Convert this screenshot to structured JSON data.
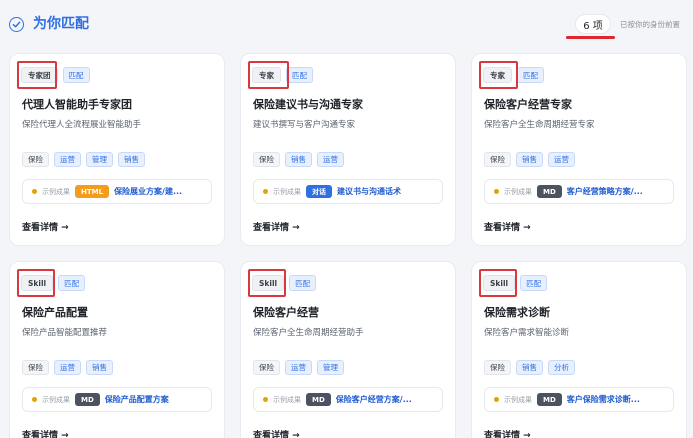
{
  "header": {
    "title": "为你匹配",
    "count": "6 项",
    "sort_note": "已按你的身份前置",
    "accent_color": "#2f6fe4",
    "highlight_color": "#d9383f"
  },
  "cards": [
    {
      "type": "专家团",
      "match": "匹配",
      "title": "代理人智能助手专家团",
      "desc": "保险代理人全流程展业智能助手",
      "tags": [
        {
          "label": "保险",
          "style": "plain"
        },
        {
          "label": "运营",
          "style": "blue"
        },
        {
          "label": "管理",
          "style": "blue"
        },
        {
          "label": "销售",
          "style": "blue"
        }
      ],
      "sample_label": "示例成果",
      "format": "HTML",
      "format_color": "orange",
      "sample_title": "保险展业方案/建...",
      "link": "查看详情 →"
    },
    {
      "type": "专家",
      "match": "匹配",
      "title": "保险建议书与沟通专家",
      "desc": "建议书撰写与客户沟通专家",
      "tags": [
        {
          "label": "保险",
          "style": "plain"
        },
        {
          "label": "销售",
          "style": "blue"
        },
        {
          "label": "运营",
          "style": "blue"
        }
      ],
      "sample_label": "示例成果",
      "format": "对话",
      "format_color": "blue",
      "sample_title": "建议书与沟通话术",
      "link": "查看详情 →"
    },
    {
      "type": "专家",
      "match": "匹配",
      "title": "保险客户经营专家",
      "desc": "保险客户全生命周期经营专家",
      "tags": [
        {
          "label": "保险",
          "style": "plain"
        },
        {
          "label": "销售",
          "style": "blue"
        },
        {
          "label": "运营",
          "style": "blue"
        }
      ],
      "sample_label": "示例成果",
      "format": "MD",
      "format_color": "dark",
      "sample_title": "客户经营策略方案/...",
      "link": "查看详情 →"
    },
    {
      "type": "Skill",
      "match": "匹配",
      "title": "保险产品配置",
      "desc": "保险产品智能配置推荐",
      "tags": [
        {
          "label": "保险",
          "style": "plain"
        },
        {
          "label": "运营",
          "style": "blue"
        },
        {
          "label": "销售",
          "style": "blue"
        }
      ],
      "sample_label": "示例成果",
      "format": "MD",
      "format_color": "dark",
      "sample_title": "保险产品配置方案",
      "link": "查看详情 →"
    },
    {
      "type": "Skill",
      "match": "匹配",
      "title": "保险客户经营",
      "desc": "保险客户全生命周期经营助手",
      "tags": [
        {
          "label": "保险",
          "style": "plain"
        },
        {
          "label": "运营",
          "style": "blue"
        },
        {
          "label": "管理",
          "style": "blue"
        }
      ],
      "sample_label": "示例成果",
      "format": "MD",
      "format_color": "dark",
      "sample_title": "保险客户经营方案/...",
      "link": "查看详情 →"
    },
    {
      "type": "Skill",
      "match": "匹配",
      "title": "保险需求诊断",
      "desc": "保险客户需求智能诊断",
      "tags": [
        {
          "label": "保险",
          "style": "plain"
        },
        {
          "label": "销售",
          "style": "blue"
        },
        {
          "label": "分析",
          "style": "blue"
        }
      ],
      "sample_label": "示例成果",
      "format": "MD",
      "format_color": "dark",
      "sample_title": "客户保险需求诊断...",
      "link": "查看详情 →"
    }
  ]
}
